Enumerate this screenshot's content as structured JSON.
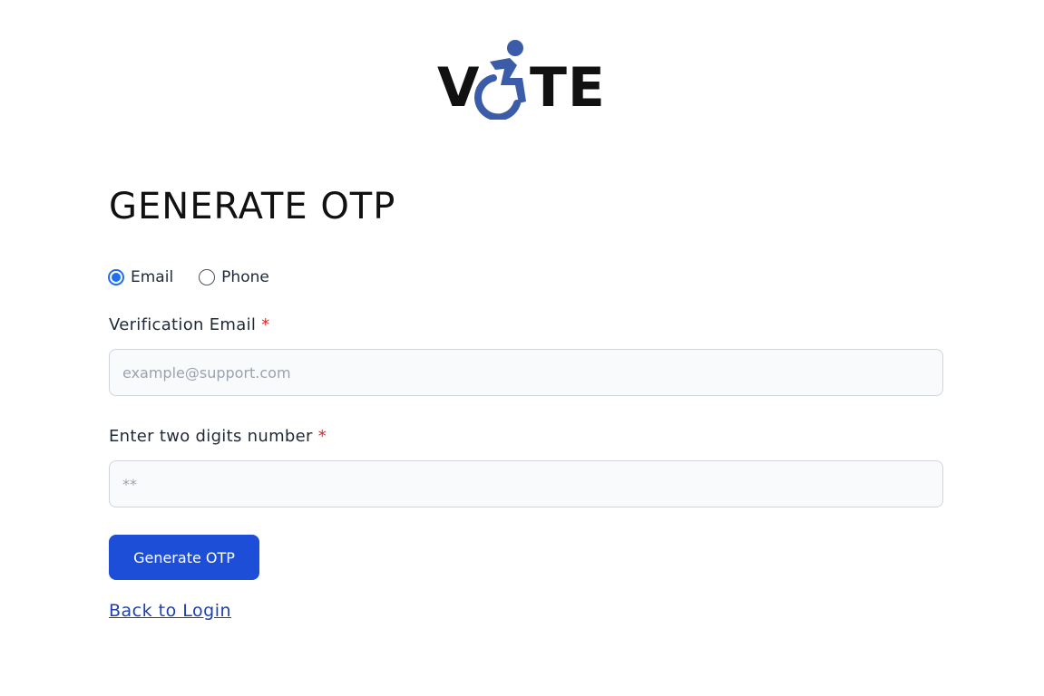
{
  "logo": {
    "text_left": "V",
    "text_right": "TE",
    "icon": "accessibility-wheelchair-icon",
    "icon_color": "#3b5ca8"
  },
  "page": {
    "title": "GENERATE OTP"
  },
  "method_options": [
    {
      "label": "Email",
      "checked": true
    },
    {
      "label": "Phone",
      "checked": false
    }
  ],
  "email_field": {
    "label": "Verification Email",
    "required_marker": "*",
    "placeholder": "example@support.com",
    "value": ""
  },
  "digits_field": {
    "label": "Enter two digits number",
    "required_marker": "*",
    "placeholder": "**",
    "value": ""
  },
  "actions": {
    "generate_label": "Generate OTP",
    "back_link": "Back to Login"
  },
  "colors": {
    "primary": "#1d4ed8",
    "radio_accent": "#1d6ff0",
    "required": "#dc2626",
    "link": "#1e40af"
  }
}
